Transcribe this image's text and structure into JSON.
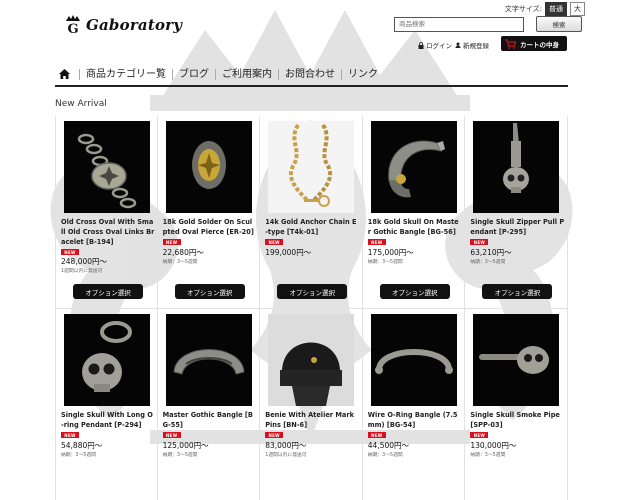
{
  "header": {
    "logo_text": "Gaboratory",
    "font_size_label": "文字サイズ:",
    "font_size_options": [
      "普通",
      "大"
    ],
    "search_placeholder": "商品検索",
    "search_button": "検索",
    "login_label": "ログイン",
    "register_label": "新規登録",
    "cart_label": "カートの中身"
  },
  "nav": {
    "home_icon": "home-icon",
    "items": [
      "商品カテゴリー覧",
      "ブログ",
      "ご利用案内",
      "お問合わせ",
      "リンク"
    ]
  },
  "section_title": "New Arrival",
  "new_badge": "NEW",
  "option_button": "オプション選択",
  "products": [
    {
      "name": "Old Cross Oval With Small Old Cross Oval Links Bracelet [B-194]",
      "price": "248,000円～",
      "delivery": "1週間以内に発送可"
    },
    {
      "name": "18k Gold Solder On Sculpted Oval Pierce [ER-20]",
      "price": "22,680円～",
      "delivery": "納期：3～5週間"
    },
    {
      "name": "14k Gold Anchor Chain E-type [T4k-01]",
      "price": "199,000円～",
      "delivery": ""
    },
    {
      "name": "18k Gold Skull On Master Gothic Bangle [BG-56]",
      "price": "175,000円～",
      "delivery": "納期：3～5週間"
    },
    {
      "name": "Single Skull Zipper Pull Pendant [P-295]",
      "price": "63,210円～",
      "delivery": "納期：3～5週間"
    },
    {
      "name": "Single Skull With Long O-ring Pendant [P-294]",
      "price": "54,880円～",
      "delivery": "納期：3～5週間"
    },
    {
      "name": "Master Gothic Bangle [BG-55]",
      "price": "125,000円～",
      "delivery": "納期：3～5週間"
    },
    {
      "name": "Benie With Atelier Mark Pins [BN-6]",
      "price": "83,000円～",
      "delivery": "1週間以内に発送可"
    },
    {
      "name": "Wire O-Ring Bangle (7.5mm) [BG-54]",
      "price": "44,500円～",
      "delivery": "納期：3～5週間"
    },
    {
      "name": "Single Skull Smoke Pipe [SPP-03]",
      "price": "130,000円～",
      "delivery": "納期：3～5週間"
    }
  ],
  "colors": {
    "accent": "#d7101e",
    "dark": "#111111"
  }
}
